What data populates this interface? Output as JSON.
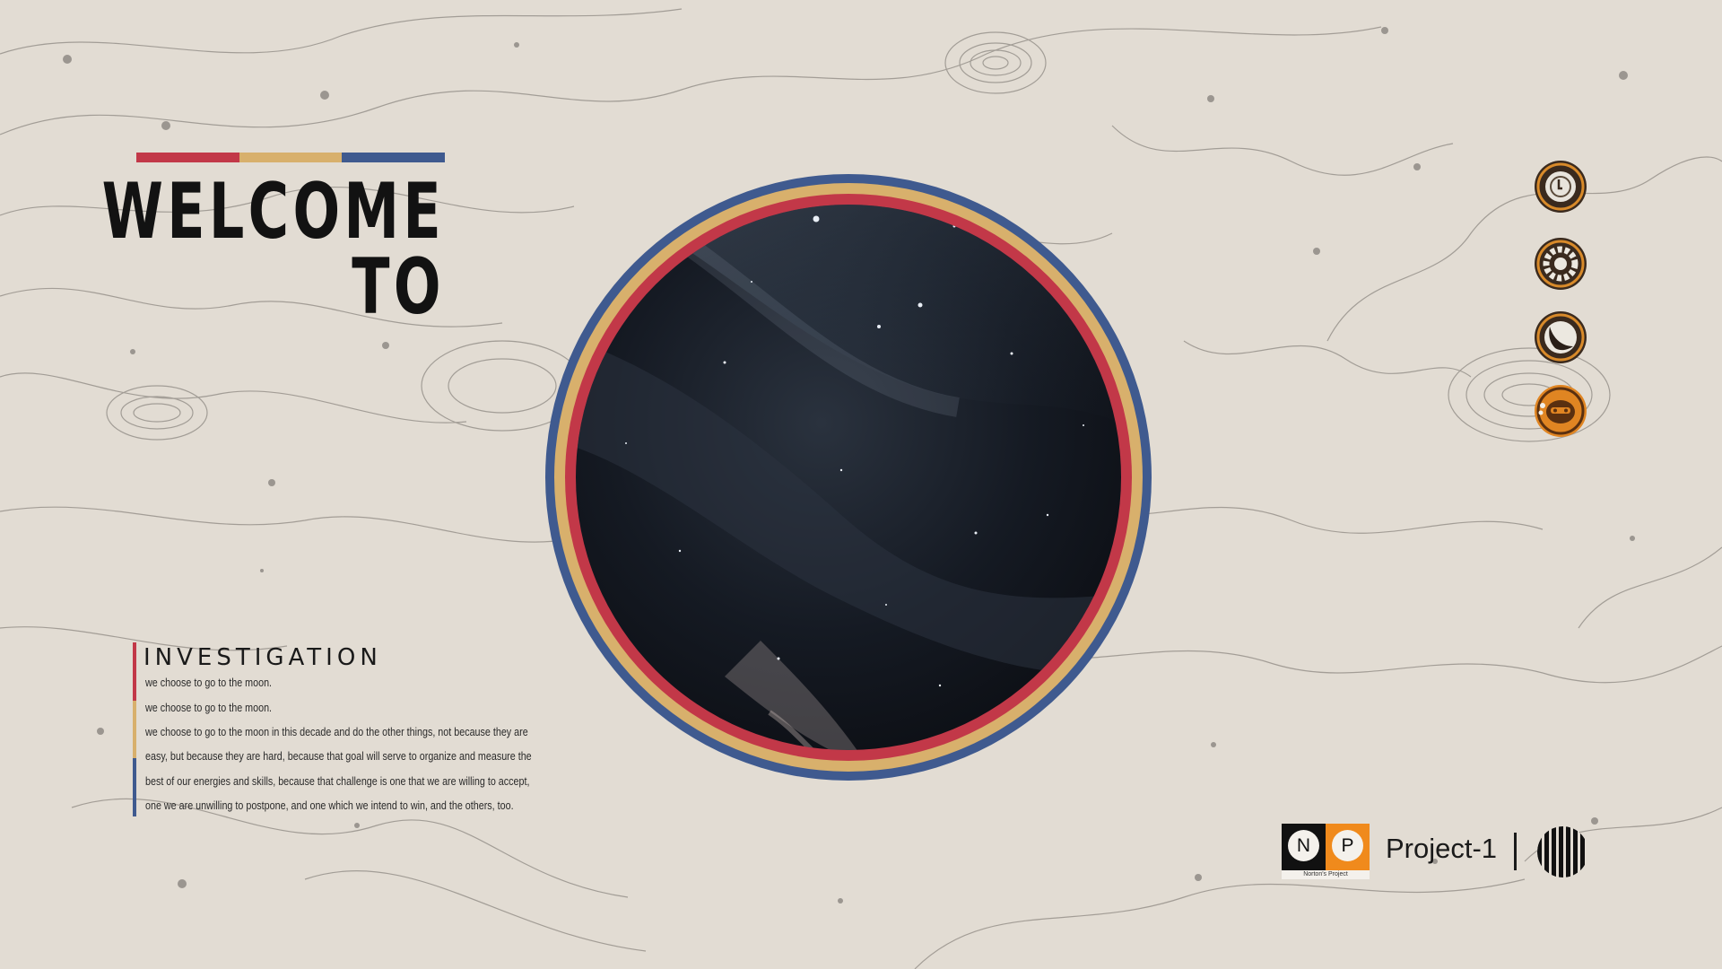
{
  "hero": {
    "title_line1": "WELCOME",
    "title_line2": "TO"
  },
  "colors": {
    "background": "#e2dcd3",
    "red": "#c23848",
    "gold": "#d8b06c",
    "blue": "#3f5a8f",
    "orange": "#ef8a1b",
    "dark": "#121212"
  },
  "nav": {
    "items": [
      {
        "icon": "planet-ring-icon"
      },
      {
        "icon": "gear-ring-icon"
      },
      {
        "icon": "crescent-moon-icon"
      },
      {
        "icon": "robot-face-icon"
      }
    ]
  },
  "investigation": {
    "heading": "INVESTIGATION",
    "lines": [
      "we choose to go to the moon.",
      "we choose to go to the moon.",
      "we choose to go to the moon in this decade and do the other things, not because they are",
      "easy, but because they are hard, because that goal will serve to organize and measure the",
      "best of our energies and skills, because that challenge is one that we are willing to accept,",
      "one we are unwilling to postpone, and one which we intend to win, and the others, too."
    ]
  },
  "brand": {
    "logo_left": "N",
    "logo_right": "P",
    "logo_caption": "Norton's Project",
    "project_label": "Project-1"
  }
}
